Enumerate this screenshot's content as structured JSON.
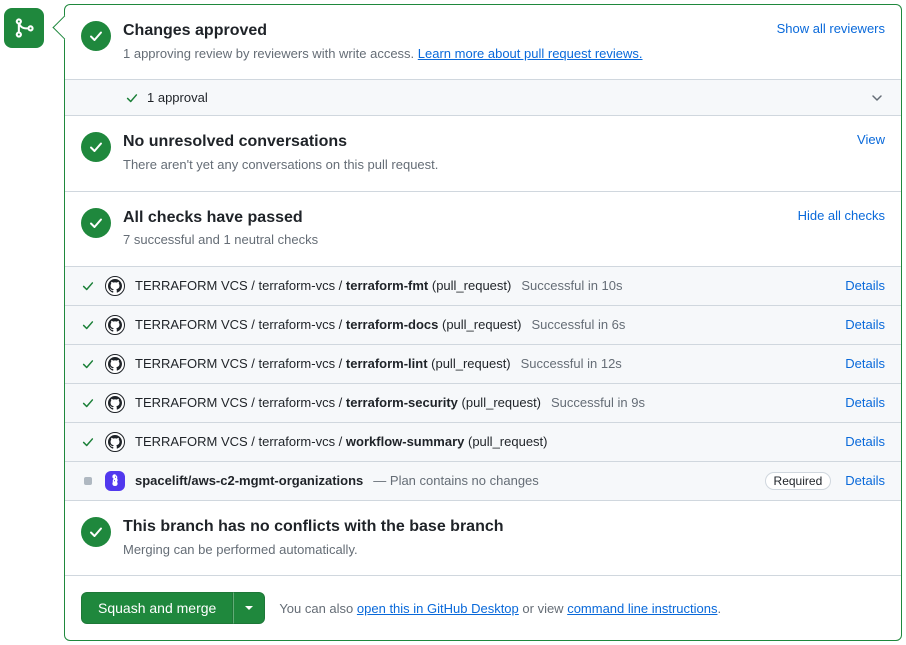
{
  "approved": {
    "title": "Changes approved",
    "sub_prefix": "1 approving review by reviewers with write access. ",
    "learn_more": "Learn more about pull request reviews.",
    "show_all": "Show all reviewers",
    "approval_count": "1 approval"
  },
  "conversations": {
    "title": "No unresolved conversations",
    "sub": "There aren't yet any conversations on this pull request.",
    "action": "View"
  },
  "checks_header": {
    "title": "All checks have passed",
    "sub": "7 successful and 1 neutral checks",
    "action": "Hide all checks"
  },
  "checks": [
    {
      "status": "success",
      "avatar": "gh",
      "name_prefix": "TERRAFORM VCS / terraform-vcs / ",
      "name_bold": "terraform-fmt",
      "name_suffix": " (pull_request)",
      "desc": "Successful in 10s"
    },
    {
      "status": "success",
      "avatar": "gh",
      "name_prefix": "TERRAFORM VCS / terraform-vcs / ",
      "name_bold": "terraform-docs",
      "name_suffix": " (pull_request)",
      "desc": "Successful in 6s"
    },
    {
      "status": "success",
      "avatar": "gh",
      "name_prefix": "TERRAFORM VCS / terraform-vcs / ",
      "name_bold": "terraform-lint",
      "name_suffix": " (pull_request)",
      "desc": "Successful in 12s"
    },
    {
      "status": "success",
      "avatar": "gh",
      "name_prefix": "TERRAFORM VCS / terraform-vcs / ",
      "name_bold": "terraform-security",
      "name_suffix": " (pull_request)",
      "desc": "Successful in 9s"
    },
    {
      "status": "success",
      "avatar": "gh",
      "name_prefix": "TERRAFORM VCS / terraform-vcs / ",
      "name_bold": "workflow-summary",
      "name_suffix": " (pull_request)",
      "desc": ""
    },
    {
      "status": "neutral",
      "avatar": "spacelift",
      "name_prefix": "",
      "name_bold": "spacelift/aws-c2-mgmt-organizations",
      "name_suffix": "",
      "desc": "— Plan contains no changes",
      "required": true
    }
  ],
  "conflicts": {
    "title": "This branch has no conflicts with the base branch",
    "sub": "Merging can be performed automatically."
  },
  "footer": {
    "button": "Squash and merge",
    "text_prefix": "You can also ",
    "desktop_link": "open this in GitHub Desktop",
    "text_mid": " or view ",
    "cli_link": "command line instructions",
    "text_suffix": "."
  },
  "labels": {
    "details": "Details",
    "required": "Required"
  }
}
